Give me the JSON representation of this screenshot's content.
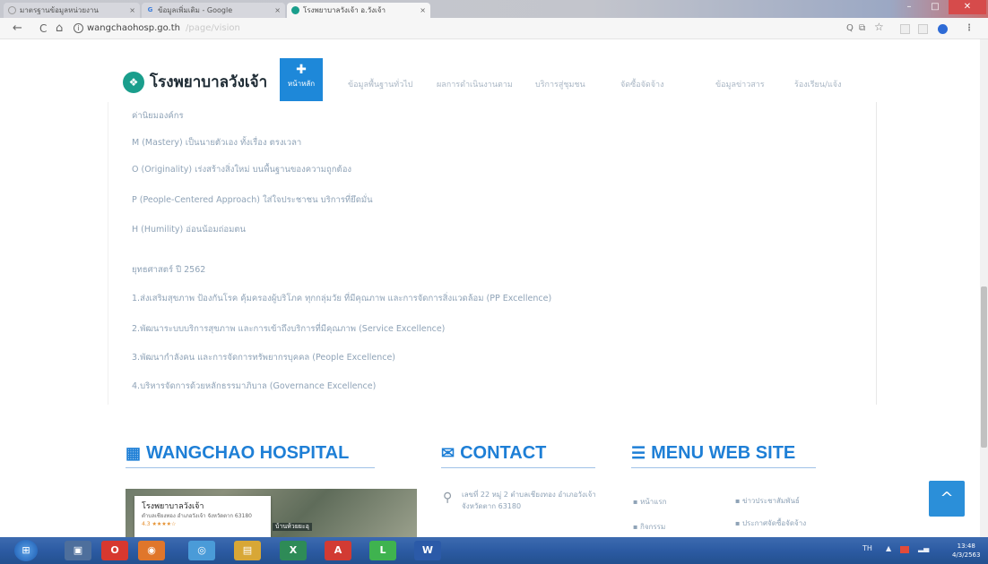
{
  "browser": {
    "tabs": [
      {
        "title": "มาตรฐานข้อมูลหน่วยงาน",
        "icon": "page-icon",
        "active": false
      },
      {
        "title": "ข้อมูลเพิ่มเติม - Google",
        "icon": "google-icon",
        "active": false
      },
      {
        "title": "โรงพยาบาลวังเจ้า อ.วังเจ้า",
        "icon": "site-icon",
        "active": true
      }
    ],
    "close_glyph": "×",
    "address": {
      "url": "wangchaohosp.go.th",
      "path_faded": "/page/vision",
      "info_glyph": "i"
    },
    "toolbar_glyphs": {
      "back": "←",
      "reload": "C",
      "home": "⌂",
      "zoom": "Q",
      "translate": "⧉",
      "star": "☆",
      "menu": "⋮"
    },
    "window_controls": {
      "minimize": "–",
      "maximize": "□",
      "close": "✕"
    }
  },
  "site": {
    "logo_glyph": "❖",
    "name": "โรงพยาบาลวังเจ้า",
    "home_button": {
      "glyph": "✚",
      "label": "หน้าหลัก"
    },
    "menu": [
      "ข้อมูลพื้นฐานทั่วไป",
      "ผลการดำเนินงานตาม",
      "บริการสู่ชุมชน",
      "จัดซื้อจัดจ้าง",
      "ข้อมูลข่าวสาร",
      "ร้องเรียน/แจ้ง"
    ]
  },
  "content": {
    "values_heading": "ค่านิยมองค์กร",
    "values": [
      "M (Mastery) เป็นนายตัวเอง ทั้งเรื่อง ตรงเวลา",
      "O (Originality) เร่งสร้างสิ่งใหม่ บนพื้นฐานของความถูกต้อง",
      "P (People-Centered Approach) ใส่ใจประชาชน บริการที่ยึดมั่น",
      "H (Humility) อ่อนน้อมถ่อมตน"
    ],
    "strategy_heading": "ยุทธศาสตร์ ปี 2562",
    "strategies": [
      "1.ส่งเสริมสุขภาพ ป้องกันโรค คุ้มครองผู้บริโภค ทุกกลุ่มวัย ที่มีคุณภาพ และการจัดการสิ่งแวดล้อม (PP Excellence)",
      "2.พัฒนาระบบบริการสุขภาพ และการเข้าถึงบริการที่มีคุณภาพ (Service Excellence)",
      "3.พัฒนากำลังคน และการจัดการทรัพยากรบุคคล (People Excellence)",
      "4.บริหารจัดการด้วยหลักธรรมาภิบาล (Governance Excellence)"
    ]
  },
  "footer": {
    "hospital": {
      "icon": "building-icon",
      "glyph": "▦",
      "title": "WANGCHAO HOSPITAL"
    },
    "contact": {
      "icon": "envelope-icon",
      "glyph": "✉",
      "title": "CONTACT"
    },
    "menu": {
      "icon": "list-icon",
      "glyph": "☰",
      "title": "MENU WEB SITE"
    },
    "map": {
      "name": "โรงพยาบาลวังเจ้า",
      "address": "ตำบลเชียงทอง อำเภอวังเจ้า จังหวัดตาก 63180",
      "stars": "4.3 ★★★★☆",
      "strip": "บ้านห้วยยะอุ"
    },
    "address_glyph": "⚲",
    "address_text": "เลขที่ 22 หมู่ 2 ตำบลเชียงทอง อำเภอวังเจ้า จังหวัดตาก 63180",
    "menu_links": [
      "หน้าแรก",
      "ข่าวประชาสัมพันธ์",
      "กิจกรรม",
      "ประกาศจัดซื้อจัดจ้าง"
    ],
    "scroll_top_glyph": "^"
  },
  "taskbar": {
    "start_glyph": "⊞",
    "apps": [
      {
        "name": "explorer",
        "glyph": "▣",
        "color": "#4e6f9c"
      },
      {
        "name": "opera",
        "glyph": "O",
        "color": "#d7382f"
      },
      {
        "name": "firefox",
        "glyph": "◉",
        "color": "#e0762b"
      },
      {
        "name": "chrome",
        "glyph": "◎",
        "color": "#4a9bd8"
      },
      {
        "name": "files",
        "glyph": "▤",
        "color": "#d8a736"
      },
      {
        "name": "excel",
        "glyph": "X",
        "color": "#2e8b57"
      },
      {
        "name": "pdf",
        "glyph": "A",
        "color": "#d23b33"
      },
      {
        "name": "line",
        "glyph": "L",
        "color": "#3fb34f"
      },
      {
        "name": "word",
        "glyph": "W",
        "color": "#2b5aa8"
      }
    ],
    "tray": {
      "lang": "TH",
      "arrow": "▲",
      "time": "13:48",
      "date": "4/3/2563"
    }
  }
}
